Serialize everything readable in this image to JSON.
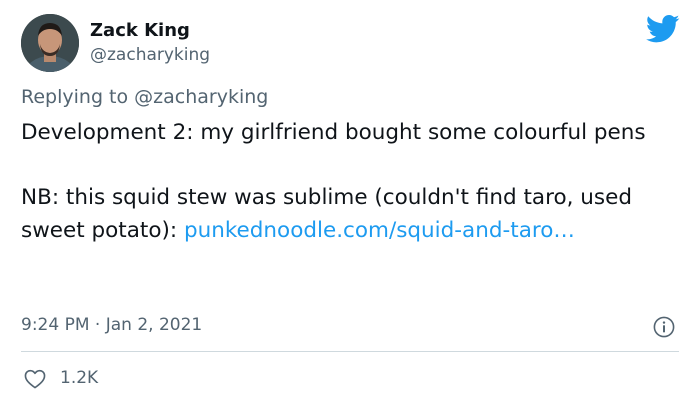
{
  "author": {
    "display_name": "Zack King",
    "handle": "@zacharyking"
  },
  "reply": {
    "prefix": "Replying to ",
    "mention": "@zacharyking"
  },
  "tweet": {
    "paragraph1": "Development 2: my girlfriend bought some colourful pens",
    "paragraph2_text": "NB: this squid stew was sublime (couldn't find taro, used sweet potato): ",
    "paragraph2_link": "punkednoodle.com/squid-and-taro…"
  },
  "meta": {
    "timestamp": "9:24 PM · Jan 2, 2021"
  },
  "stats": {
    "likes": "1.2K"
  },
  "icons": {
    "brand": "twitter-bird-icon",
    "info": "info-icon",
    "like": "heart-icon"
  },
  "colors": {
    "link": "#1d9bf0",
    "secondary_text": "#536471",
    "brand": "#1d9bf0"
  }
}
